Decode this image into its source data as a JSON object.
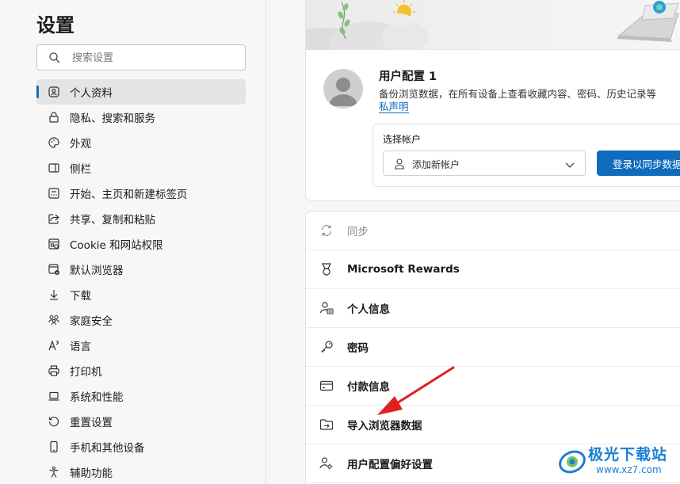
{
  "sidebar": {
    "title": "设置",
    "search_placeholder": "搜索设置",
    "items": [
      {
        "label": "个人资料",
        "icon": "profile-icon",
        "active": true
      },
      {
        "label": "隐私、搜索和服务",
        "icon": "lock-icon"
      },
      {
        "label": "外观",
        "icon": "palette-icon"
      },
      {
        "label": "侧栏",
        "icon": "sidebar-icon"
      },
      {
        "label": "开始、主页和新建标签页",
        "icon": "home-tab-icon"
      },
      {
        "label": "共享、复制和粘贴",
        "icon": "share-icon"
      },
      {
        "label": "Cookie 和网站权限",
        "icon": "cookie-icon"
      },
      {
        "label": "默认浏览器",
        "icon": "browser-icon"
      },
      {
        "label": "下载",
        "icon": "download-icon"
      },
      {
        "label": "家庭安全",
        "icon": "family-icon"
      },
      {
        "label": "语言",
        "icon": "language-icon"
      },
      {
        "label": "打印机",
        "icon": "printer-icon"
      },
      {
        "label": "系统和性能",
        "icon": "laptop-icon"
      },
      {
        "label": "重置设置",
        "icon": "reset-icon"
      },
      {
        "label": "手机和其他设备",
        "icon": "phone-icon"
      },
      {
        "label": "辅助功能",
        "icon": "accessibility-icon"
      }
    ]
  },
  "profile": {
    "name": "用户配置 1",
    "description": "备份浏览数据，在所有设备上查看收藏内容、密码、历史记录等",
    "privacy_link": "私声明",
    "account_label": "选择帐户",
    "account_select_value": "添加新帐户",
    "signin_button": "登录以同步数据"
  },
  "options": [
    {
      "label": "同步",
      "icon": "sync-icon",
      "disabled": true
    },
    {
      "label": "Microsoft Rewards",
      "icon": "rewards-icon"
    },
    {
      "label": "个人信息",
      "icon": "personal-info-icon"
    },
    {
      "label": "密码",
      "icon": "key-icon"
    },
    {
      "label": "付款信息",
      "icon": "credit-card-icon"
    },
    {
      "label": "导入浏览器数据",
      "icon": "import-icon"
    },
    {
      "label": "用户配置偏好设置",
      "icon": "profile-preferences-icon"
    }
  ],
  "watermark": {
    "title": "极光下载站",
    "url": "www.xz7.com"
  },
  "colors": {
    "accent": "#0f6cbd",
    "annotation_arrow": "#e02020"
  }
}
